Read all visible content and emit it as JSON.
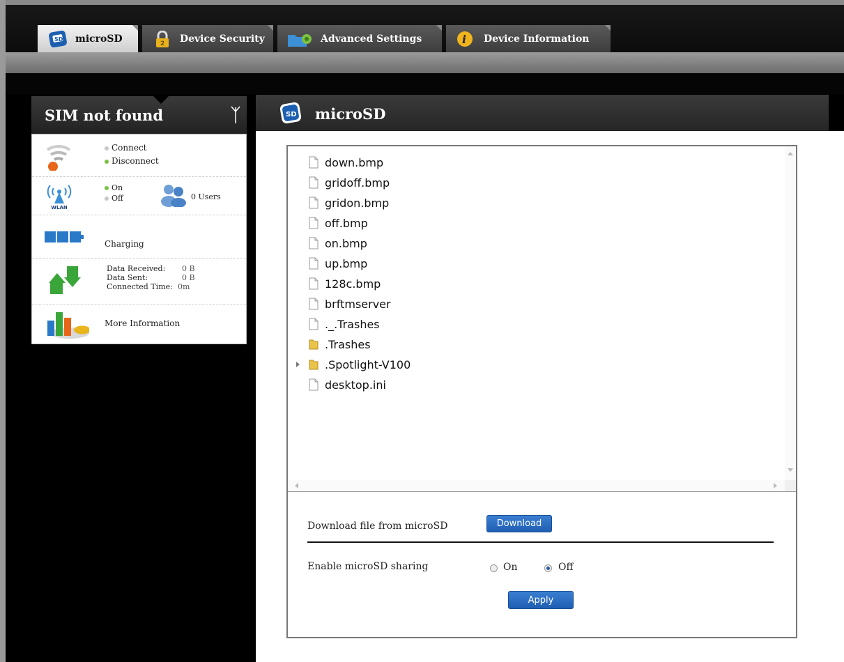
{
  "tabs": [
    {
      "label": "microSD",
      "icon": "sd-card-icon",
      "active": true
    },
    {
      "label": "Device Security",
      "icon": "padlock-icon",
      "active": false
    },
    {
      "label": "Advanced Settings",
      "icon": "folder-gear-icon",
      "active": false
    },
    {
      "label": "Device Information",
      "icon": "info-icon",
      "active": false
    }
  ],
  "status": {
    "title": "SIM not found",
    "connect_label": "Connect",
    "disconnect_label": "Disconnect",
    "wlan_on_label": "On",
    "wlan_off_label": "Off",
    "wlan_icon_label": "WLAN",
    "users_label": "0 Users",
    "battery_label": "Charging",
    "data_received_label": "Data Received:",
    "data_received_value": "0 B",
    "data_sent_label": "Data Sent:",
    "data_sent_value": "0 B",
    "connected_time_label": "Connected Time:",
    "connected_time_value": "0m",
    "more_info_label": "More Information"
  },
  "content": {
    "title": "microSD",
    "files": [
      {
        "name": "down.bmp",
        "type": "file"
      },
      {
        "name": "gridoff.bmp",
        "type": "file"
      },
      {
        "name": "gridon.bmp",
        "type": "file"
      },
      {
        "name": "off.bmp",
        "type": "file"
      },
      {
        "name": "on.bmp",
        "type": "file"
      },
      {
        "name": "up.bmp",
        "type": "file"
      },
      {
        "name": "128c.bmp",
        "type": "file"
      },
      {
        "name": "brftmserver",
        "type": "file"
      },
      {
        "name": "._.Trashes",
        "type": "file"
      },
      {
        "name": ".Trashes",
        "type": "folder"
      },
      {
        "name": ".Spotlight-V100",
        "type": "folder",
        "expandable": true
      },
      {
        "name": "desktop.ini",
        "type": "file"
      }
    ],
    "download_label": "Download file from microSD",
    "download_button": "Download",
    "sharing_label": "Enable microSD sharing",
    "sharing_on_label": "On",
    "sharing_off_label": "Off",
    "sharing_selected": "Off",
    "apply_button": "Apply"
  },
  "colors": {
    "accent_button": "#2a6cc4",
    "status_dot_on": "#7ac143"
  }
}
